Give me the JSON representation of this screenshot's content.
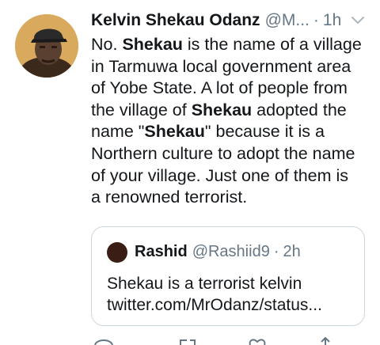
{
  "tweet": {
    "author_name": "Kelvin Shekau Odanz",
    "handle": "@M...",
    "separator": "·",
    "time": "1h",
    "body_lines": [
      [
        {
          "t": "No. ",
          "b": false
        },
        {
          "t": "Shekau",
          "b": true
        },
        {
          "t": " is the name of a village",
          "b": false
        }
      ],
      [
        {
          "t": "in Tarmuwa local government area",
          "b": false
        }
      ],
      [
        {
          "t": "of Yobe State. A lot of people from",
          "b": false
        }
      ],
      [
        {
          "t": "the village of ",
          "b": false
        },
        {
          "t": "Shekau",
          "b": true
        },
        {
          "t": " adopted the",
          "b": false
        }
      ],
      [
        {
          "t": "name \"",
          "b": false
        },
        {
          "t": "Shekau",
          "b": true
        },
        {
          "t": "\" because it is a",
          "b": false
        }
      ],
      [
        {
          "t": "Northern culture to adopt the name",
          "b": false
        }
      ],
      [
        {
          "t": "of your village. Just one of them is",
          "b": false
        }
      ],
      [
        {
          "t": "a renowned terrorist.",
          "b": false
        }
      ]
    ]
  },
  "quoted": {
    "author_name": "Rashid",
    "handle": "@Rashiid9",
    "separator": "·",
    "time": "2h",
    "text_line1": "Shekau is a terrorist kelvin",
    "text_line2": "twitter.com/MrOdanz/status..."
  },
  "icons": {
    "avatar": "user-avatar-photo",
    "menu": "chevron-down-icon",
    "actions": [
      "reply-icon",
      "retweet-icon",
      "like-icon",
      "share-icon"
    ]
  },
  "colors": {
    "text": "#14171a",
    "secondary": "#657786",
    "border": "#ccd6dd",
    "avatar_bg": "#d9aa5e"
  }
}
